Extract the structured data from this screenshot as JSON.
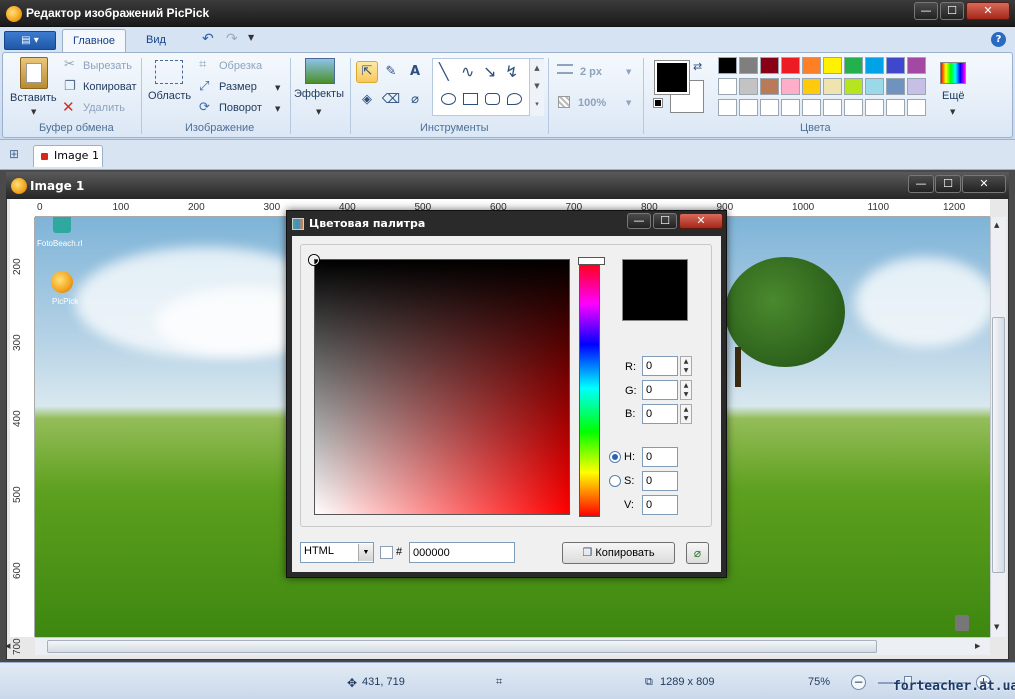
{
  "app": {
    "title": "Редактор изображений PicPick"
  },
  "ribbon": {
    "tabs": [
      "Главное",
      "Вид"
    ],
    "clipboard": {
      "paste": "Вставить",
      "cut": "Вырезать",
      "copy": "Копироват",
      "delete": "Удалить",
      "group": "Буфер обмена"
    },
    "image": {
      "area": "Область",
      "crop": "Обрезка",
      "resize": "Размер",
      "rotate": "Поворот",
      "group": "Изображение"
    },
    "effects": {
      "label": "Эффекты"
    },
    "tools": {
      "group": "Инструменты"
    },
    "size": {
      "stroke": "2 px",
      "opacity": "100%"
    },
    "colors": {
      "group": "Цвета",
      "more": "Ещё",
      "palette_row1": [
        "#000000",
        "#7f7f7f",
        "#880015",
        "#ed1c24",
        "#ff7f27",
        "#fff200",
        "#22b14c",
        "#00a2e8",
        "#3f48cc",
        "#a349a4"
      ],
      "palette_row2": [
        "#ffffff",
        "#c3c3c3",
        "#b97a57",
        "#ffaec9",
        "#ffc90e",
        "#efe4b0",
        "#b5e61d",
        "#99d9ea",
        "#7092be",
        "#c8bfe7"
      ],
      "palette_row3": [
        "#ffffff",
        "#ffffff",
        "#ffffff",
        "#ffffff",
        "#ffffff",
        "#ffffff",
        "#ffffff",
        "#ffffff",
        "#ffffff",
        "#ffffff"
      ],
      "primary": "#000000",
      "secondary": "#ffffff"
    }
  },
  "doc": {
    "tab": "Image 1",
    "window_title": "Image 1"
  },
  "ruler": {
    "h": [
      "0",
      "100",
      "200",
      "300",
      "400",
      "500",
      "600",
      "700",
      "800",
      "900",
      "1000",
      "1100",
      "1200"
    ],
    "v": [
      "200",
      "300",
      "400",
      "500",
      "600",
      "700"
    ]
  },
  "desktop": {
    "icon1": "FotoBeach.rl",
    "icon2": "PicPick"
  },
  "dialog": {
    "title": "Цветовая палитра",
    "r_label": "R:",
    "r": "0",
    "g_label": "G:",
    "g": "0",
    "b_label": "B:",
    "b": "0",
    "h_label": "H:",
    "h": "0",
    "s_label": "S:",
    "s": "0",
    "v_label": "V:",
    "v": "0",
    "format": "HTML",
    "hash": "#",
    "hex": "000000",
    "copy": "Копировать"
  },
  "status": {
    "pos": "431, 719",
    "size": "1289 x 809",
    "zoom": "75%",
    "watermark": "forteacher.at.ua"
  }
}
